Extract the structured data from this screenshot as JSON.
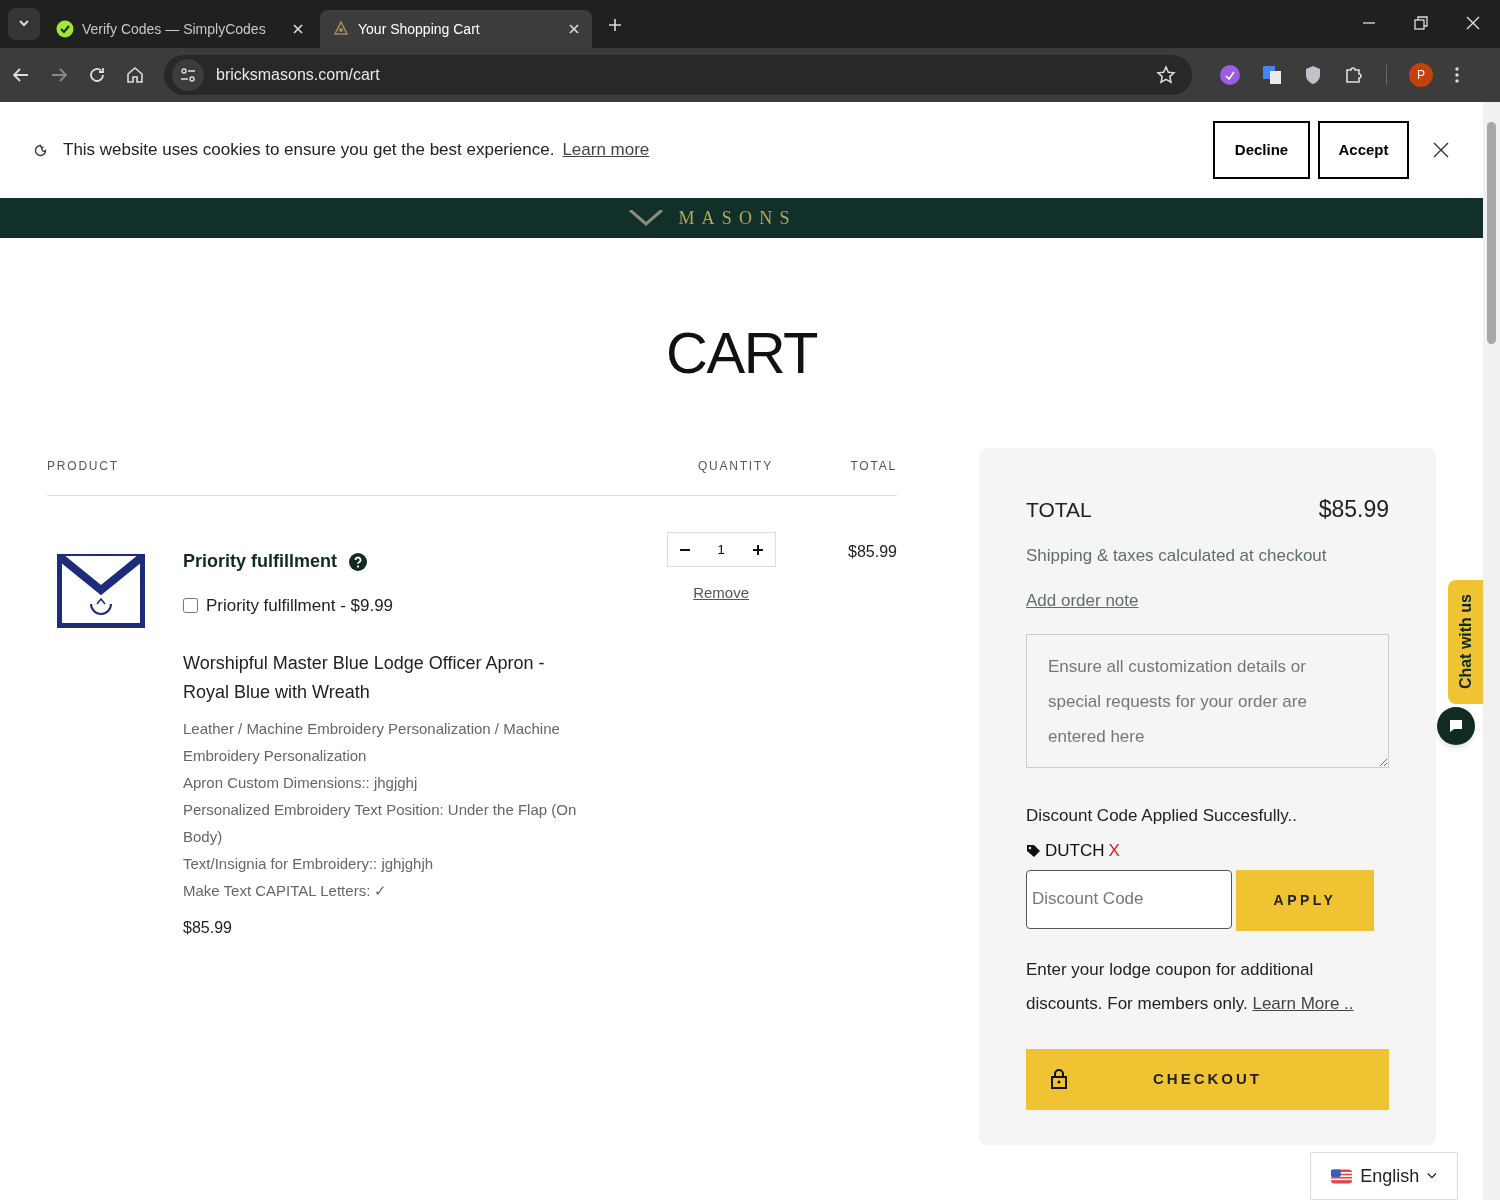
{
  "browser": {
    "tabs": [
      {
        "title": "Verify Codes — SimplyCodes",
        "selected": false
      },
      {
        "title": "Your Shopping Cart",
        "selected": true
      }
    ],
    "url": "bricksmasons.com/cart",
    "profile_initial": "P"
  },
  "cookie_banner": {
    "text": "This website uses cookies to ensure you get the best experience.",
    "link": "Learn more",
    "buttons": [
      "Decline",
      "Accept"
    ]
  },
  "header": {
    "logo_text": "MASONS"
  },
  "page_title": "CART",
  "table": {
    "columns": [
      "PRODUCT",
      "QUANTITY",
      "TOTAL"
    ],
    "items": [
      {
        "addon_title": "Priority fulfillment",
        "addon_option": {
          "label": "Priority fulfillment - $9.99",
          "checked": false
        },
        "name": "Worshipful Master Blue Lodge Officer Apron - Royal Blue with Wreath",
        "properties": [
          "Leather / Machine Embroidery Personalization / Machine Embroidery Personalization",
          "Apron Custom Dimensions:: jhgjghj",
          "Personalized Embroidery Text Position: Under the Flap (On Body)",
          "Text/Insignia for Embroidery:: jghjghjh",
          "Make Text CAPITAL Letters: ✓"
        ],
        "price": "$85.99",
        "quantity": "1",
        "remove": "Remove",
        "line_total": "$85.99"
      }
    ]
  },
  "summary": {
    "total_label": "TOTAL",
    "total": "$85.99",
    "shipping_note": "Shipping & taxes calculated at checkout",
    "order_note_link": "Add order note",
    "order_note_placeholder": "Ensure all customization details or special requests for your order are entered here",
    "discount_message": "Discount Code Applied Succesfully..",
    "applied_code": "DUTCH",
    "remove_code": "X",
    "discount_placeholder": "Discount Code",
    "apply_button": "APPLY",
    "coupon_note": "Enter your lodge coupon for additional discounts. For members only.",
    "coupon_link": "Learn More ..",
    "checkout": "CHECKOUT"
  },
  "chat_tab": "Chat with us",
  "language": "English"
}
